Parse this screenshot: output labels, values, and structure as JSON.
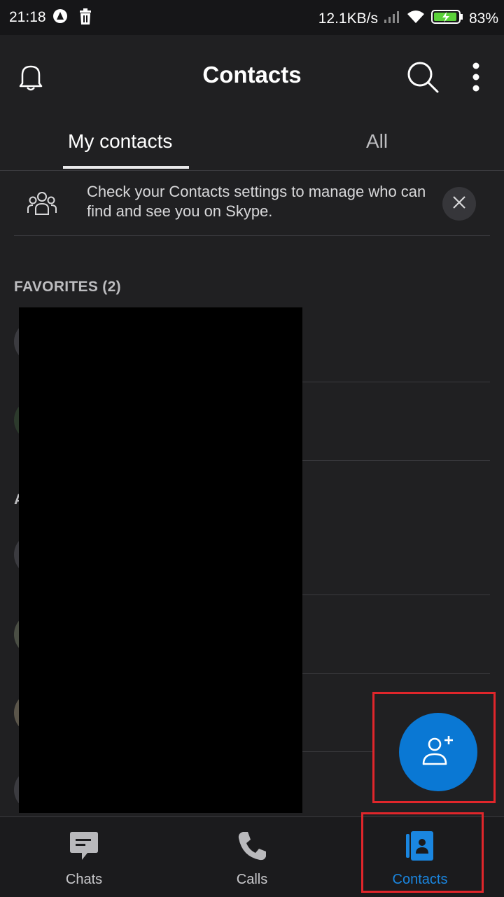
{
  "status_bar": {
    "time": "21:18",
    "net_speed": "12.1KB/s",
    "battery": "83%"
  },
  "header": {
    "title": "Contacts"
  },
  "tabs": [
    {
      "label": "My contacts",
      "active": true
    },
    {
      "label": "All",
      "active": false
    }
  ],
  "banner": {
    "text": "Check your Contacts settings to manage who can find and see you on Skype."
  },
  "sections": {
    "favorites": "FAVORITES (2)",
    "all_letter": "A"
  },
  "bottom_nav": [
    {
      "label": "Chats",
      "icon": "chat-icon",
      "active": false
    },
    {
      "label": "Calls",
      "icon": "phone-icon",
      "active": false
    },
    {
      "label": "Contacts",
      "icon": "contacts-book-icon",
      "active": true
    }
  ],
  "colors": {
    "accent": "#0a78d4",
    "active_nav": "#1a86e0",
    "highlight": "#e0262b",
    "background": "#202022"
  }
}
